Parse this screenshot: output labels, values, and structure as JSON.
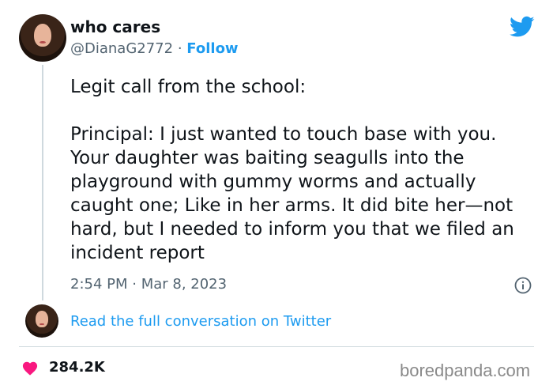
{
  "author": {
    "name": "who cares",
    "handle": "@DianaG2772",
    "separator": "·",
    "follow_label": "Follow"
  },
  "tweet": {
    "text": "Legit call from the school:\n\nPrincipal: I just wanted to touch base with you.  Your daughter was baiting seagulls into the playground with gummy worms and actually caught one; Like in her arms. It did bite her—not hard, but I needed to inform you that we filed an incident report",
    "timestamp": "2:54 PM · Mar 8, 2023"
  },
  "read_full_label": "Read the full conversation on Twitter",
  "likes_count": "284.2K",
  "watermark": "boredpanda.com",
  "icons": {
    "brand": "twitter-bird-icon",
    "info": "info-icon",
    "like": "heart-icon"
  },
  "colors": {
    "accent": "#1d9bf0",
    "heart": "#f91880",
    "muted_text": "#536471",
    "line": "#cfd9de"
  }
}
